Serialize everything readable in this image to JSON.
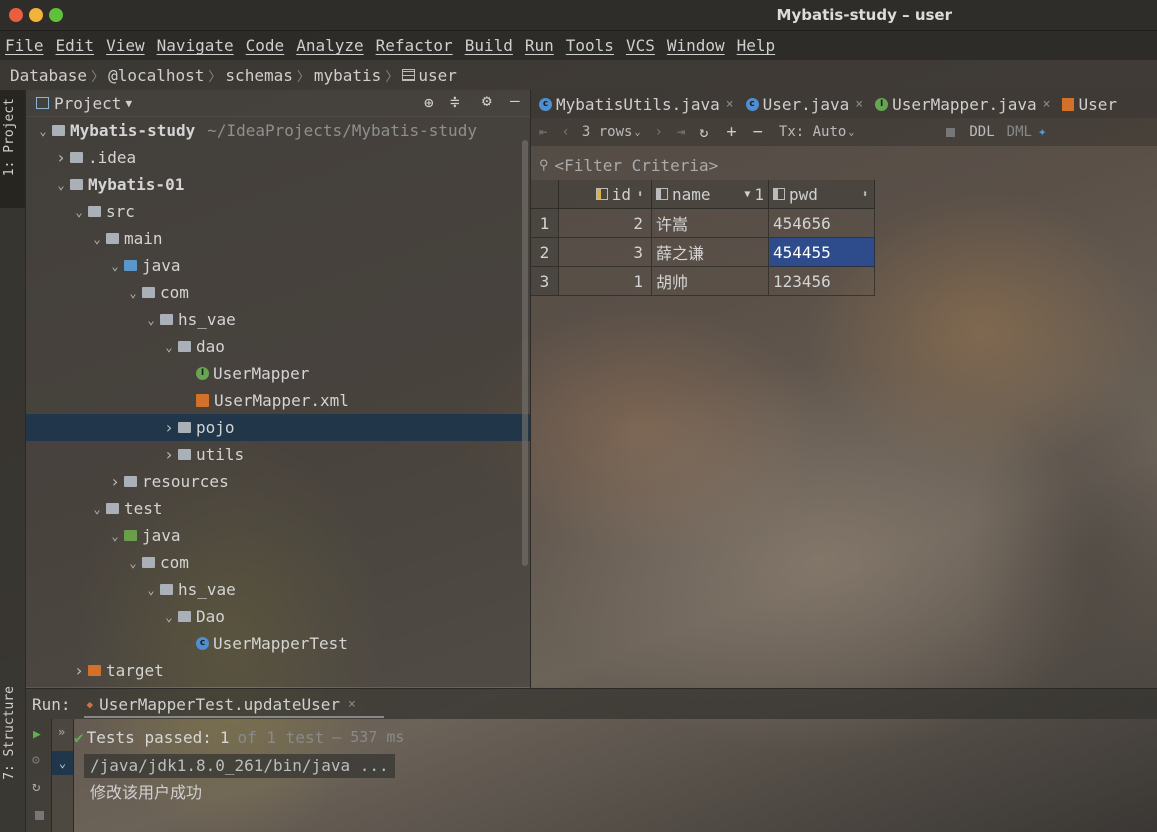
{
  "window": {
    "title": "Mybatis-study – user"
  },
  "colors": {
    "selection": "#1c344c",
    "cell_selected": "#2e4b8c",
    "pass_green": "#5fae52",
    "folder_blue": "#5a97c8",
    "folder_green": "#6a9e4d",
    "target_orange": "#d3712a"
  },
  "menu": [
    "File",
    "Edit",
    "View",
    "Navigate",
    "Code",
    "Analyze",
    "Refactor",
    "Build",
    "Run",
    "Tools",
    "VCS",
    "Window",
    "Help"
  ],
  "breadcrumb": [
    "Database",
    "@localhost",
    "schemas",
    "mybatis",
    "user"
  ],
  "side_tabs": {
    "project": "1: Project",
    "structure": "7: Structure"
  },
  "project": {
    "title": "Project",
    "tree": [
      {
        "label": "Mybatis-study",
        "suffix": "~/IdeaProjects/Mybatis-study",
        "depth": 0,
        "expanded": true,
        "kind": "module",
        "bold": true
      },
      {
        "label": ".idea",
        "depth": 1,
        "expanded": false,
        "kind": "folder"
      },
      {
        "label": "Mybatis-01",
        "depth": 1,
        "expanded": true,
        "kind": "module",
        "bold": true
      },
      {
        "label": "src",
        "depth": 2,
        "expanded": true,
        "kind": "folder"
      },
      {
        "label": "main",
        "depth": 3,
        "expanded": true,
        "kind": "folder"
      },
      {
        "label": "java",
        "depth": 4,
        "expanded": true,
        "kind": "src-folder"
      },
      {
        "label": "com",
        "depth": 5,
        "expanded": true,
        "kind": "package"
      },
      {
        "label": "hs_vae",
        "depth": 6,
        "expanded": true,
        "kind": "package"
      },
      {
        "label": "dao",
        "depth": 7,
        "expanded": true,
        "kind": "package"
      },
      {
        "label": "UserMapper",
        "depth": 8,
        "kind": "interface"
      },
      {
        "label": "UserMapper.xml",
        "depth": 8,
        "kind": "xml"
      },
      {
        "label": "pojo",
        "depth": 7,
        "expanded": false,
        "kind": "package",
        "selected": true
      },
      {
        "label": "utils",
        "depth": 7,
        "expanded": false,
        "kind": "package"
      },
      {
        "label": "resources",
        "depth": 4,
        "expanded": false,
        "kind": "resources"
      },
      {
        "label": "test",
        "depth": 3,
        "expanded": true,
        "kind": "folder"
      },
      {
        "label": "java",
        "depth": 4,
        "expanded": true,
        "kind": "test-folder"
      },
      {
        "label": "com",
        "depth": 5,
        "expanded": true,
        "kind": "package"
      },
      {
        "label": "hs_vae",
        "depth": 6,
        "expanded": true,
        "kind": "package"
      },
      {
        "label": "Dao",
        "depth": 7,
        "expanded": true,
        "kind": "package"
      },
      {
        "label": "UserMapperTest",
        "depth": 8,
        "kind": "test-class"
      },
      {
        "label": "target",
        "depth": 2,
        "expanded": false,
        "kind": "target"
      }
    ]
  },
  "editor_tabs": [
    {
      "label": "MybatisUtils.java",
      "icon": "class"
    },
    {
      "label": "User.java",
      "icon": "class"
    },
    {
      "label": "UserMapper.java",
      "icon": "interface"
    },
    {
      "label": "User",
      "icon": "xml"
    }
  ],
  "db_toolbar": {
    "rows": "3 rows",
    "tx": "Tx: Auto",
    "ddl": "DDL",
    "dml": "DML"
  },
  "filter": {
    "placeholder": "<Filter Criteria>"
  },
  "table": {
    "columns": [
      {
        "name": "id"
      },
      {
        "name": "name",
        "sort": "1"
      },
      {
        "name": "pwd"
      }
    ],
    "rows": [
      {
        "n": "1",
        "id": "2",
        "name": "许嵩",
        "pwd": "454656"
      },
      {
        "n": "2",
        "id": "3",
        "name": "薛之谦",
        "pwd": "454455"
      },
      {
        "n": "3",
        "id": "1",
        "name": "胡帅",
        "pwd": "123456"
      }
    ]
  },
  "run": {
    "label": "Run:",
    "tab": "UserMapperTest.updateUser",
    "status_prefix": "Tests passed:",
    "passed": "1",
    "of_total": "of 1 test",
    "duration": "— 537 ms",
    "cmd": "/java/jdk1.8.0_261/bin/java ...",
    "output": "修改该用户成功"
  }
}
